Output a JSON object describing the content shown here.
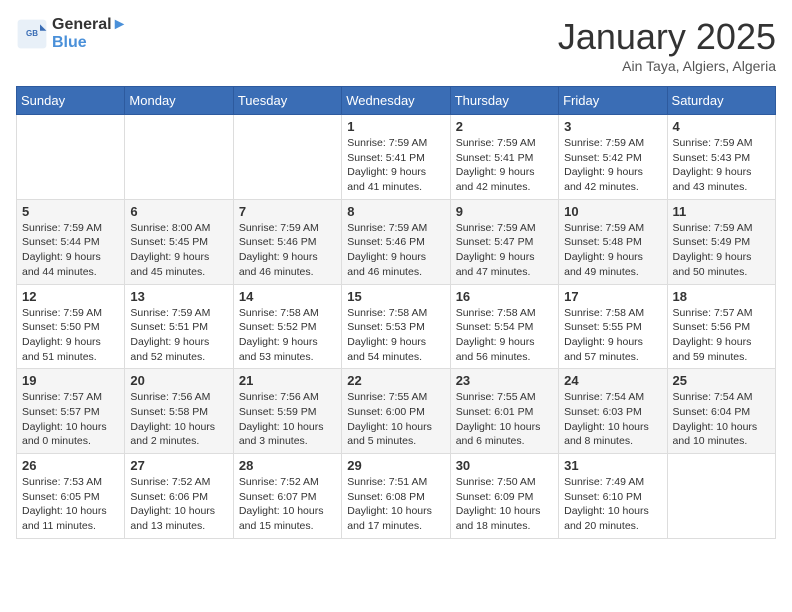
{
  "logo": {
    "line1": "General",
    "line2": "Blue"
  },
  "title": "January 2025",
  "subtitle": "Ain Taya, Algiers, Algeria",
  "days_header": [
    "Sunday",
    "Monday",
    "Tuesday",
    "Wednesday",
    "Thursday",
    "Friday",
    "Saturday"
  ],
  "weeks": [
    [
      {
        "day": "",
        "info": ""
      },
      {
        "day": "",
        "info": ""
      },
      {
        "day": "",
        "info": ""
      },
      {
        "day": "1",
        "info": "Sunrise: 7:59 AM\nSunset: 5:41 PM\nDaylight: 9 hours\nand 41 minutes."
      },
      {
        "day": "2",
        "info": "Sunrise: 7:59 AM\nSunset: 5:41 PM\nDaylight: 9 hours\nand 42 minutes."
      },
      {
        "day": "3",
        "info": "Sunrise: 7:59 AM\nSunset: 5:42 PM\nDaylight: 9 hours\nand 42 minutes."
      },
      {
        "day": "4",
        "info": "Sunrise: 7:59 AM\nSunset: 5:43 PM\nDaylight: 9 hours\nand 43 minutes."
      }
    ],
    [
      {
        "day": "5",
        "info": "Sunrise: 7:59 AM\nSunset: 5:44 PM\nDaylight: 9 hours\nand 44 minutes."
      },
      {
        "day": "6",
        "info": "Sunrise: 8:00 AM\nSunset: 5:45 PM\nDaylight: 9 hours\nand 45 minutes."
      },
      {
        "day": "7",
        "info": "Sunrise: 7:59 AM\nSunset: 5:46 PM\nDaylight: 9 hours\nand 46 minutes."
      },
      {
        "day": "8",
        "info": "Sunrise: 7:59 AM\nSunset: 5:46 PM\nDaylight: 9 hours\nand 46 minutes."
      },
      {
        "day": "9",
        "info": "Sunrise: 7:59 AM\nSunset: 5:47 PM\nDaylight: 9 hours\nand 47 minutes."
      },
      {
        "day": "10",
        "info": "Sunrise: 7:59 AM\nSunset: 5:48 PM\nDaylight: 9 hours\nand 49 minutes."
      },
      {
        "day": "11",
        "info": "Sunrise: 7:59 AM\nSunset: 5:49 PM\nDaylight: 9 hours\nand 50 minutes."
      }
    ],
    [
      {
        "day": "12",
        "info": "Sunrise: 7:59 AM\nSunset: 5:50 PM\nDaylight: 9 hours\nand 51 minutes."
      },
      {
        "day": "13",
        "info": "Sunrise: 7:59 AM\nSunset: 5:51 PM\nDaylight: 9 hours\nand 52 minutes."
      },
      {
        "day": "14",
        "info": "Sunrise: 7:58 AM\nSunset: 5:52 PM\nDaylight: 9 hours\nand 53 minutes."
      },
      {
        "day": "15",
        "info": "Sunrise: 7:58 AM\nSunset: 5:53 PM\nDaylight: 9 hours\nand 54 minutes."
      },
      {
        "day": "16",
        "info": "Sunrise: 7:58 AM\nSunset: 5:54 PM\nDaylight: 9 hours\nand 56 minutes."
      },
      {
        "day": "17",
        "info": "Sunrise: 7:58 AM\nSunset: 5:55 PM\nDaylight: 9 hours\nand 57 minutes."
      },
      {
        "day": "18",
        "info": "Sunrise: 7:57 AM\nSunset: 5:56 PM\nDaylight: 9 hours\nand 59 minutes."
      }
    ],
    [
      {
        "day": "19",
        "info": "Sunrise: 7:57 AM\nSunset: 5:57 PM\nDaylight: 10 hours\nand 0 minutes."
      },
      {
        "day": "20",
        "info": "Sunrise: 7:56 AM\nSunset: 5:58 PM\nDaylight: 10 hours\nand 2 minutes."
      },
      {
        "day": "21",
        "info": "Sunrise: 7:56 AM\nSunset: 5:59 PM\nDaylight: 10 hours\nand 3 minutes."
      },
      {
        "day": "22",
        "info": "Sunrise: 7:55 AM\nSunset: 6:00 PM\nDaylight: 10 hours\nand 5 minutes."
      },
      {
        "day": "23",
        "info": "Sunrise: 7:55 AM\nSunset: 6:01 PM\nDaylight: 10 hours\nand 6 minutes."
      },
      {
        "day": "24",
        "info": "Sunrise: 7:54 AM\nSunset: 6:03 PM\nDaylight: 10 hours\nand 8 minutes."
      },
      {
        "day": "25",
        "info": "Sunrise: 7:54 AM\nSunset: 6:04 PM\nDaylight: 10 hours\nand 10 minutes."
      }
    ],
    [
      {
        "day": "26",
        "info": "Sunrise: 7:53 AM\nSunset: 6:05 PM\nDaylight: 10 hours\nand 11 minutes."
      },
      {
        "day": "27",
        "info": "Sunrise: 7:52 AM\nSunset: 6:06 PM\nDaylight: 10 hours\nand 13 minutes."
      },
      {
        "day": "28",
        "info": "Sunrise: 7:52 AM\nSunset: 6:07 PM\nDaylight: 10 hours\nand 15 minutes."
      },
      {
        "day": "29",
        "info": "Sunrise: 7:51 AM\nSunset: 6:08 PM\nDaylight: 10 hours\nand 17 minutes."
      },
      {
        "day": "30",
        "info": "Sunrise: 7:50 AM\nSunset: 6:09 PM\nDaylight: 10 hours\nand 18 minutes."
      },
      {
        "day": "31",
        "info": "Sunrise: 7:49 AM\nSunset: 6:10 PM\nDaylight: 10 hours\nand 20 minutes."
      },
      {
        "day": "",
        "info": ""
      }
    ]
  ]
}
